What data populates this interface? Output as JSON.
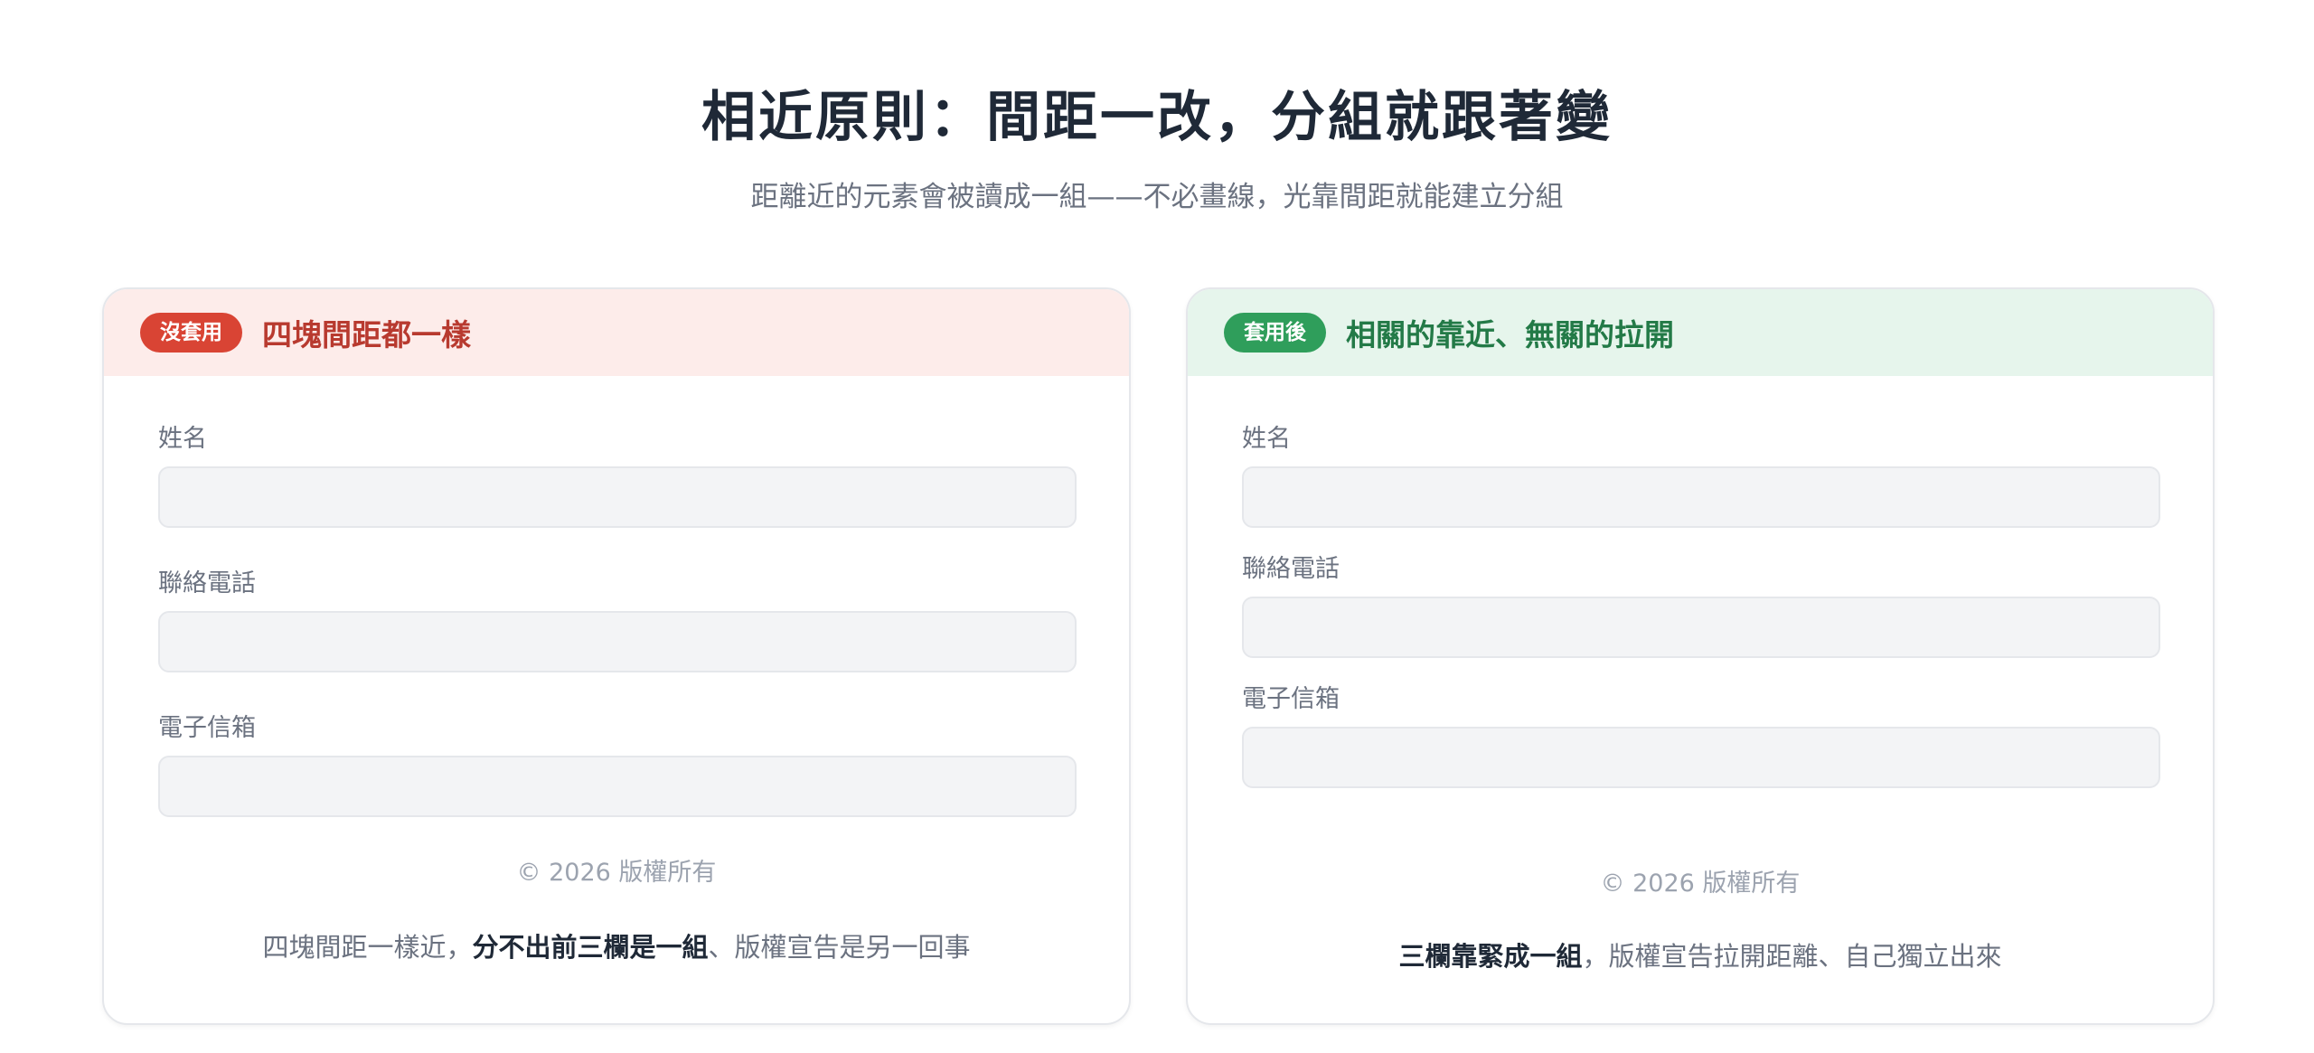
{
  "page": {
    "title": "相近原則：間距一改，分組就跟著變",
    "subtitle": "距離近的元素會被讀成一組——不必畫線，光靠間距就能建立分組"
  },
  "left_card": {
    "badge": "沒套用",
    "title": "四塊間距都一樣",
    "fields": [
      {
        "label": "姓名",
        "value": ""
      },
      {
        "label": "聯絡電話",
        "value": ""
      },
      {
        "label": "電子信箱",
        "value": ""
      }
    ],
    "copyright": "© 2026 版權所有",
    "caption": {
      "prefix": "四塊間距一樣近，",
      "strong": "分不出前三欄是一組",
      "suffix": "、版權宣告是另一回事"
    }
  },
  "right_card": {
    "badge": "套用後",
    "title": "相關的靠近、無關的拉開",
    "fields": [
      {
        "label": "姓名",
        "value": ""
      },
      {
        "label": "聯絡電話",
        "value": ""
      },
      {
        "label": "電子信箱",
        "value": ""
      }
    ],
    "copyright": "© 2026 版權所有",
    "caption": {
      "prefix": "",
      "strong": "三欄靠緊成一組",
      "suffix": "，版權宣告拉開距離、自己獨立出來"
    }
  },
  "colors": {
    "bad_accent": "#d94434",
    "good_accent": "#2f9e5b",
    "bad_header_bg": "#fdecea",
    "good_header_bg": "#e6f5ec"
  }
}
